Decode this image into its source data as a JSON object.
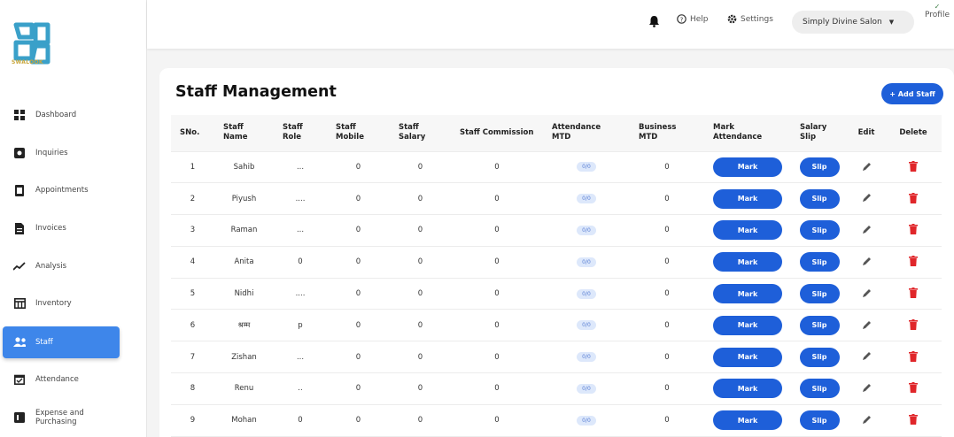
{
  "brand": {
    "name": "SWALOOK"
  },
  "sidebar": {
    "items": [
      {
        "label": "Dashboard",
        "icon": "dashboard-icon"
      },
      {
        "label": "Inquiries",
        "icon": "inquiries-icon"
      },
      {
        "label": "Appointments",
        "icon": "appointments-icon"
      },
      {
        "label": "Invoices",
        "icon": "invoices-icon"
      },
      {
        "label": "Analysis",
        "icon": "analysis-icon"
      },
      {
        "label": "Inventory",
        "icon": "inventory-icon"
      },
      {
        "label": "Staff",
        "icon": "staff-icon",
        "active": true
      },
      {
        "label": "Attendance",
        "icon": "attendance-icon"
      },
      {
        "label": "Expense and Purchasing",
        "icon": "expense-icon"
      }
    ]
  },
  "topbar": {
    "help": "Help",
    "settings": "Settings",
    "salon": "Simply Divine Salon",
    "profile": "Profile"
  },
  "page": {
    "title": "Staff Management",
    "add_staff": "+ Add Staff"
  },
  "table": {
    "headers": [
      "SNo.",
      "Staff Name",
      "Staff Role",
      "Staff Mobile",
      "Staff Salary",
      "Staff Commission",
      "Attendance MTD",
      "Business MTD",
      "Mark Attendance",
      "Salary Slip",
      "Edit",
      "Delete"
    ],
    "mark_label": "Mark",
    "slip_label": "Slip",
    "rows": [
      {
        "sno": "1",
        "name": "Sahib",
        "role": "...",
        "mobile": "0",
        "salary": "0",
        "commission": "0",
        "attendance": "0/0",
        "business": "0"
      },
      {
        "sno": "2",
        "name": "Piyush",
        "role": "....",
        "mobile": "0",
        "salary": "0",
        "commission": "0",
        "attendance": "0/0",
        "business": "0"
      },
      {
        "sno": "3",
        "name": "Raman",
        "role": "...",
        "mobile": "0",
        "salary": "0",
        "commission": "0",
        "attendance": "0/0",
        "business": "0"
      },
      {
        "sno": "4",
        "name": "Anita",
        "role": "0",
        "mobile": "0",
        "salary": "0",
        "commission": "0",
        "attendance": "0/0",
        "business": "0"
      },
      {
        "sno": "5",
        "name": "Nidhi",
        "role": "....",
        "mobile": "0",
        "salary": "0",
        "commission": "0",
        "attendance": "0/0",
        "business": "0"
      },
      {
        "sno": "6",
        "name": "श्रम्म",
        "role": "p",
        "mobile": "0",
        "salary": "0",
        "commission": "0",
        "attendance": "0/0",
        "business": "0"
      },
      {
        "sno": "7",
        "name": "Zishan",
        "role": "...",
        "mobile": "0",
        "salary": "0",
        "commission": "0",
        "attendance": "0/0",
        "business": "0"
      },
      {
        "sno": "8",
        "name": "Renu",
        "role": "..",
        "mobile": "0",
        "salary": "0",
        "commission": "0",
        "attendance": "0/0",
        "business": "0"
      },
      {
        "sno": "9",
        "name": "Mohan",
        "role": "0",
        "mobile": "0",
        "salary": "0",
        "commission": "0",
        "attendance": "0/0",
        "business": "0"
      }
    ]
  },
  "colors": {
    "accent": "#1e5fd9",
    "active_nav": "#3e86ea",
    "delete": "#e0262a",
    "logo_teal": "#39a3b8"
  }
}
